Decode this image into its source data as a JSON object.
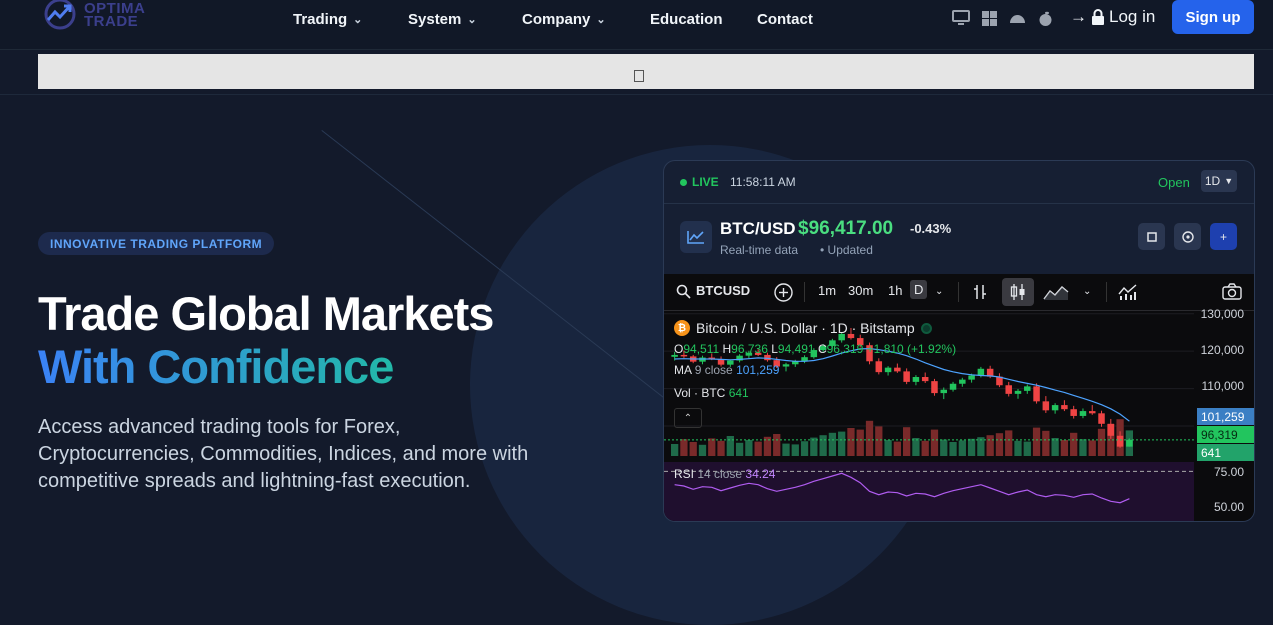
{
  "brand": {
    "logo_text_1": "OPTIMA",
    "logo_text_2": "TRADE"
  },
  "nav": {
    "items": [
      "Trading",
      "System",
      "Company",
      "Education",
      "Contact"
    ],
    "platform_icons": [
      "desktop-icon",
      "windows-icon",
      "android-icon",
      "apple-icon"
    ],
    "login_label": "Log in",
    "signup_label": "Sign up"
  },
  "hero": {
    "badge": "INNOVATIVE TRADING PLATFORM",
    "title_line1": "Trade Global Markets",
    "title_line2": "With Confidence",
    "lead": "Access advanced trading tools for Forex, Cryptocurrencies, Commodities, Indices, and more with competitive spreads and lightning-fast execution."
  },
  "widget": {
    "live_label": "LIVE",
    "time": "11:58:11 AM",
    "market_status": "Open",
    "timeframe": "1D",
    "symbol": "BTC/USD",
    "price": "$96,417.00",
    "change": "-0.43%",
    "subtitle1": "Real-time data",
    "subtitle2": "• Updated",
    "btn_plus": "+",
    "colors": {
      "up": "#22c55e",
      "down": "#ef4444",
      "accent": "#2563eb"
    }
  },
  "tv": {
    "symbol_search": "BTCUSD",
    "intervals": [
      "1m",
      "30m",
      "1h",
      "D"
    ],
    "selected_interval": "D",
    "title": "Bitcoin / U.S. Dollar · 1D · Bitstamp",
    "ohlc": {
      "o_label": "O",
      "o": "94,511",
      "h_label": "H",
      "h": "96,736",
      "l_label": "L",
      "l": "94,491",
      "c_label": "C",
      "c": "96,319",
      "chg": "+1,810 (+1.92%)"
    },
    "ma_label": "MA",
    "ma_params": "9 close",
    "ma_value": "101,259",
    "vol_label": "Vol · BTC",
    "vol_value": "641",
    "rsi_label": "RSI",
    "rsi_params": "14 close",
    "rsi_value": "34.24",
    "y_ticks": [
      "130,000",
      "120,000",
      "110,000"
    ],
    "ma_tag": "101,259",
    "price_tag": "96,319",
    "vol_tag": "641",
    "rsi_ticks": [
      "75.00",
      "50.00"
    ]
  },
  "chart_data": {
    "type": "candlestick",
    "y_unit": "USD",
    "ylim": [
      92000,
      131000
    ],
    "candles": [
      [
        118500,
        119800,
        117500,
        119000
      ],
      [
        119000,
        120200,
        118200,
        118600
      ],
      [
        118600,
        119000,
        116800,
        117200
      ],
      [
        117200,
        118800,
        116500,
        118300
      ],
      [
        118300,
        119400,
        117600,
        117900
      ],
      [
        117900,
        118600,
        115900,
        116400
      ],
      [
        116400,
        117800,
        115800,
        117500
      ],
      [
        117500,
        119200,
        117000,
        118800
      ],
      [
        118800,
        120100,
        118100,
        119600
      ],
      [
        119600,
        120500,
        118700,
        119000
      ],
      [
        119000,
        119600,
        117200,
        117600
      ],
      [
        117600,
        118400,
        115500,
        115900
      ],
      [
        115900,
        116900,
        114600,
        116500
      ],
      [
        116500,
        117700,
        115800,
        117300
      ],
      [
        117300,
        118900,
        116800,
        118400
      ],
      [
        118400,
        120800,
        118000,
        120300
      ],
      [
        120300,
        121900,
        119800,
        121400
      ],
      [
        121400,
        123300,
        120900,
        122900
      ],
      [
        122900,
        125000,
        122300,
        124600
      ],
      [
        124600,
        126200,
        123100,
        123500
      ],
      [
        123500,
        124400,
        121000,
        121600
      ],
      [
        121600,
        122300,
        116500,
        117300
      ],
      [
        117300,
        118100,
        113800,
        114400
      ],
      [
        114400,
        116000,
        113500,
        115600
      ],
      [
        115600,
        116700,
        114200,
        114600
      ],
      [
        114600,
        115400,
        111200,
        111800
      ],
      [
        111800,
        113600,
        110900,
        113100
      ],
      [
        113100,
        114300,
        111500,
        112000
      ],
      [
        112000,
        112600,
        108100,
        108800
      ],
      [
        108800,
        110300,
        107200,
        109700
      ],
      [
        109700,
        111800,
        109200,
        111300
      ],
      [
        111300,
        112900,
        110500,
        112400
      ],
      [
        112400,
        114000,
        111600,
        113500
      ],
      [
        113500,
        115800,
        113000,
        115300
      ],
      [
        115300,
        116100,
        112800,
        113200
      ],
      [
        113200,
        114100,
        110400,
        110900
      ],
      [
        110900,
        111800,
        107900,
        108600
      ],
      [
        108600,
        109900,
        107300,
        109400
      ],
      [
        109400,
        111100,
        108600,
        110600
      ],
      [
        110600,
        111400,
        106000,
        106600
      ],
      [
        106600,
        108000,
        103500,
        104200
      ],
      [
        104200,
        106100,
        103300,
        105600
      ],
      [
        105600,
        106900,
        104000,
        104500
      ],
      [
        104500,
        105400,
        102000,
        102700
      ],
      [
        102700,
        104700,
        102100,
        104000
      ],
      [
        104000,
        105600,
        103000,
        103400
      ],
      [
        103400,
        104100,
        99800,
        100600
      ],
      [
        100600,
        101900,
        96600,
        97400
      ],
      [
        97400,
        98600,
        94200,
        94500
      ],
      [
        94500,
        96700,
        94500,
        96300
      ]
    ],
    "ma_values": [
      117900,
      118000,
      117900,
      117900,
      117900,
      117800,
      117700,
      117800,
      118000,
      118200,
      118100,
      117800,
      117500,
      117300,
      117300,
      117500,
      118000,
      118700,
      119500,
      120100,
      120600,
      120700,
      120400,
      120000,
      119500,
      118800,
      117900,
      116900,
      116000,
      115100,
      114500,
      114000,
      113700,
      113500,
      113400,
      113100,
      112500,
      111900,
      111400,
      110900,
      110300,
      109600,
      109000,
      108200,
      107400,
      106600,
      105700,
      104600,
      103200,
      101300
    ],
    "volume": [
      30,
      42,
      35,
      28,
      44,
      38,
      50,
      33,
      40,
      36,
      48,
      55,
      31,
      29,
      37,
      46,
      52,
      58,
      61,
      70,
      66,
      88,
      74,
      40,
      36,
      72,
      45,
      38,
      66,
      41,
      35,
      39,
      43,
      47,
      52,
      57,
      64,
      38,
      36,
      71,
      63,
      45,
      40,
      58,
      42,
      39,
      68,
      80,
      92,
      64
    ],
    "rsi": [
      55,
      53,
      48,
      52,
      51,
      46,
      50,
      54,
      57,
      55,
      49,
      45,
      48,
      51,
      55,
      60,
      64,
      68,
      72,
      66,
      58,
      45,
      40,
      44,
      43,
      38,
      42,
      41,
      37,
      42,
      46,
      49,
      52,
      55,
      50,
      45,
      40,
      44,
      47,
      40,
      37,
      40,
      39,
      36,
      40,
      41,
      35,
      30,
      28,
      34
    ]
  }
}
